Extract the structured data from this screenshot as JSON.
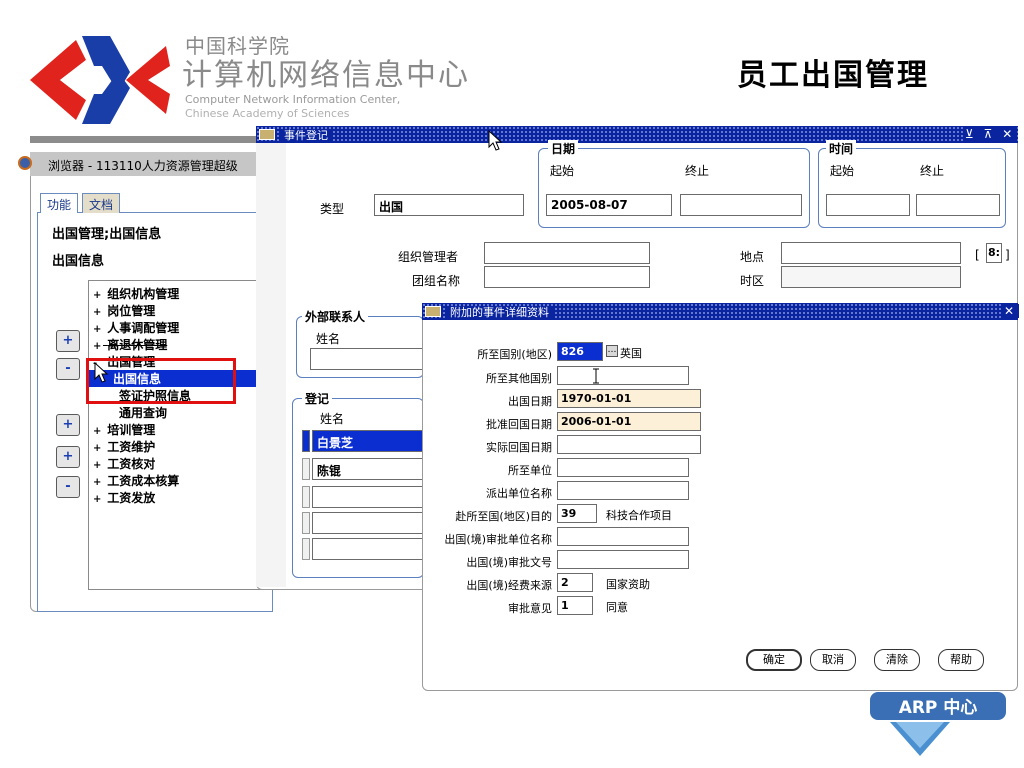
{
  "slide": {
    "org_cn": "中国科学院",
    "org_main": "计算机网络信息中心",
    "org_en_line1": "Computer Network Information Center,",
    "org_en_line2": "Chinese Academy of Sciences",
    "title": "员工出国管理",
    "badge": "ARP 中心",
    "colors": {
      "logo_red": "#e0231c",
      "logo_blue": "#1a3ea8",
      "titlebar": "#0a24a0",
      "selection": "#0b2ed0",
      "highlight": "#e01010"
    }
  },
  "navigator": {
    "title": "浏览器 - 113110人力资源管理超级",
    "tabs": [
      "功能",
      "文档"
    ],
    "path": "出国管理;出国信息",
    "section": "出国信息",
    "tree": [
      {
        "label": "组织机构管理",
        "prefix": "+"
      },
      {
        "label": "岗位管理",
        "prefix": "+"
      },
      {
        "label": "人事调配管理",
        "prefix": "+"
      },
      {
        "label": "离退休管理",
        "prefix": "+"
      },
      {
        "label": "出国管理",
        "prefix": "-"
      },
      {
        "label": "出国信息",
        "prefix": ""
      },
      {
        "label": "签证护照信息",
        "prefix": ""
      },
      {
        "label": "通用查询",
        "prefix": ""
      },
      {
        "label": "培训管理",
        "prefix": "+"
      },
      {
        "label": "工资维护",
        "prefix": "+"
      },
      {
        "label": "工资核对",
        "prefix": "+"
      },
      {
        "label": "工资成本核算",
        "prefix": "+"
      },
      {
        "label": "工资发放",
        "prefix": "+"
      }
    ],
    "buttons": {
      "expand": "+",
      "collapse": "-",
      "expand_branch": "+",
      "expand_all": "+",
      "collapse_all": "-"
    }
  },
  "event_window": {
    "title": "事件登记",
    "title_buttons": "⊻ ⊼ ✕",
    "type_label": "类型",
    "type_value": "出国",
    "date_group": "日期",
    "date_start_label": "起始",
    "date_end_label": "终止",
    "date_start_value": "2005-08-07",
    "date_end_value": "",
    "time_group": "时间",
    "time_start_label": "起始",
    "time_end_label": "终止",
    "organizer_label": "组织管理者",
    "group_name_label": "团组名称",
    "location_label": "地点",
    "timezone_label": "时区",
    "side_bracket": "[",
    "side_value": "8:",
    "side_bracket_close": "]",
    "external_group": "外部联系人",
    "external_name_label": "姓名",
    "register_group": "登记",
    "register_name_label": "姓名",
    "register_names": [
      "白景芝",
      "陈锟",
      "",
      "",
      ""
    ]
  },
  "detail_dialog": {
    "title": "附加的事件详细资料",
    "close": "✕",
    "fields": [
      {
        "label": "所至国别(地区)",
        "value": "826",
        "extra": "英国",
        "lov": "…"
      },
      {
        "label": "所至其他国别",
        "value": ""
      },
      {
        "label": "出国日期",
        "value": "1970-01-01"
      },
      {
        "label": "批准回国日期",
        "value": "2006-01-01"
      },
      {
        "label": "实际回国日期",
        "value": ""
      },
      {
        "label": "所至单位",
        "value": ""
      },
      {
        "label": "派出单位名称",
        "value": ""
      },
      {
        "label": "赴所至国(地区)目的",
        "value": "39",
        "extra": "科技合作项目"
      },
      {
        "label": "出国(境)审批单位名称",
        "value": ""
      },
      {
        "label": "出国(境)审批文号",
        "value": ""
      },
      {
        "label": "出国(境)经费来源",
        "value": "2",
        "extra": "国家资助"
      },
      {
        "label": "审批意见",
        "value": "1",
        "extra": "同意"
      }
    ],
    "buttons": {
      "ok": "确定",
      "cancel": "取消",
      "clear": "清除",
      "help": "帮助"
    }
  }
}
